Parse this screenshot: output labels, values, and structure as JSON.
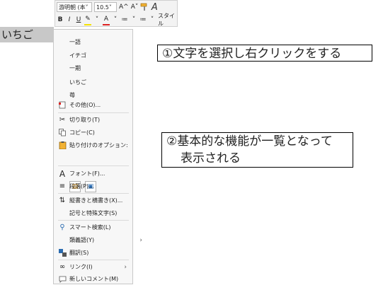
{
  "document": {
    "selected_text": "いちご"
  },
  "toolbar": {
    "font_name": "游明朝 (本",
    "font_size": "10.5",
    "grow_font": "A^",
    "shrink_font": "A˅",
    "bold": "B",
    "italic": "I",
    "underline": "U",
    "highlight": "ab",
    "font_color": "A",
    "bullets": "≔",
    "numbering": "≔",
    "styles_label": "スタイル",
    "styles_icon_text": "A"
  },
  "menu": {
    "suggestions": [
      "一語",
      "イチゴ",
      "一期",
      "いちご",
      "苺"
    ],
    "items": {
      "other": "その他(O)...",
      "cut": "切り取り(T)",
      "copy": "コピー(C)",
      "paste_options": "貼り付けのオプション:",
      "font": "フォント(F)...",
      "paragraph": "段落(P)...",
      "vertical": "縦書きと横書き(X)...",
      "symbols": "記号と特殊文字(S)",
      "smart_lookup": "スマート検索(L)",
      "synonyms": "類義語(Y)",
      "translate": "翻訳(S)",
      "link": "リンク(I)",
      "new_comment": "新しいコメント(M)"
    },
    "submenu_arrow": "›"
  },
  "callouts": {
    "first": "①文字を選択し右クリックをする",
    "second_line1": "②基本的な機能が一覧となって",
    "second_line2": "表示される"
  }
}
